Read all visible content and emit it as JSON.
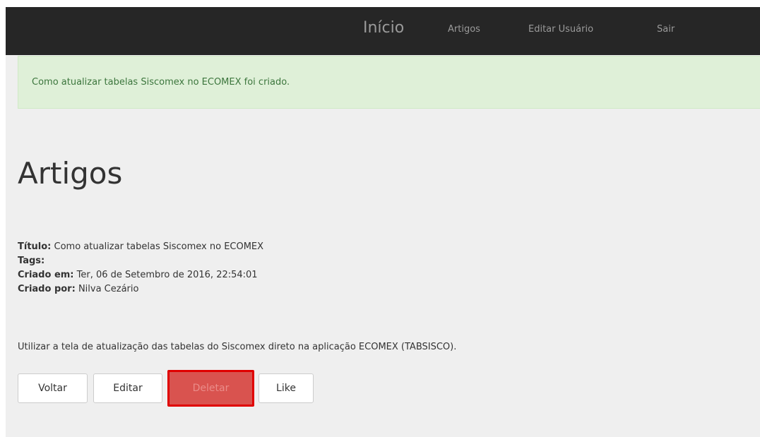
{
  "nav": {
    "brand": "Início",
    "links": [
      {
        "label": "Artigos"
      },
      {
        "label": "Editar Usuário"
      },
      {
        "label": "Sair"
      }
    ]
  },
  "alert": {
    "message": "Como atualizar tabelas Siscomex no ECOMEX foi criado."
  },
  "page": {
    "title": "Artigos"
  },
  "article": {
    "title_label": "Título:",
    "title_value": "Como atualizar tabelas Siscomex no ECOMEX",
    "tags_label": "Tags:",
    "tags_value": "",
    "created_at_label": "Criado em:",
    "created_at_value": "Ter, 06 de Setembro de 2016, 22:54:01",
    "created_by_label": "Criado por:",
    "created_by_value": "Nilva Cezário",
    "body": "Utilizar a tela de atualização das tabelas do Siscomex direto na aplicação ECOMEX (TABSISCO)."
  },
  "actions": {
    "back_label": "Voltar",
    "edit_label": "Editar",
    "delete_label": "Deletar",
    "like_label": "Like"
  },
  "colors": {
    "navbar": "#262626",
    "alert_bg": "#dff0d8",
    "alert_text": "#3c763d",
    "danger": "#d9534f",
    "highlight_border": "#e00000"
  }
}
